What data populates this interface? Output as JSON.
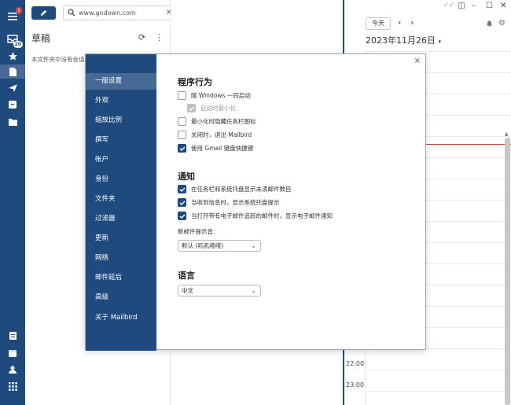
{
  "sidebar": {
    "menu_badge": "1",
    "inbox_badge": "20",
    "icons": [
      "menu-icon",
      "inbox-icon",
      "star-icon",
      "drafts-icon",
      "send-icon",
      "archive-icon",
      "folder-icon",
      "notes-icon",
      "calendar-icon",
      "contacts-icon",
      "apps-icon"
    ]
  },
  "mail_list": {
    "search_value": "www.gndown.com",
    "folder_title": "草稿",
    "empty_message": "本文件夹中没有会话"
  },
  "calendar": {
    "today_label": "今天",
    "date_label": "2023年11月26日",
    "hours": [
      "22:00",
      "23:00"
    ]
  },
  "settings": {
    "close_label": "×",
    "nav": [
      {
        "label": "一般设置",
        "active": true
      },
      {
        "label": "外观"
      },
      {
        "label": "缩放比例"
      },
      {
        "label": "撰写"
      },
      {
        "label": "帐户"
      },
      {
        "label": "身份"
      },
      {
        "label": "文件夹"
      },
      {
        "label": "过滤器"
      },
      {
        "label": "更新"
      },
      {
        "label": "网络"
      },
      {
        "label": "邮件延后"
      },
      {
        "label": "高级"
      },
      {
        "label": "关于 Mailbird"
      }
    ],
    "behavior": {
      "title": "程序行为",
      "options": [
        {
          "label": "随 Windows 一同启动",
          "checked": false
        },
        {
          "label": "启动时最小化",
          "checked": true,
          "disabled": true
        },
        {
          "label": "最小化时隐藏任务栏图标",
          "checked": false
        },
        {
          "label": "关闭时，退出 Mailbird",
          "checked": false
        },
        {
          "label": "使用 Gmail 键盘快捷键",
          "checked": true
        }
      ]
    },
    "notifications": {
      "title": "通知",
      "options": [
        {
          "label": "在任务栏和系统托盘显示未读邮件数目",
          "checked": true
        },
        {
          "label": "当收到信息时，显示系统托盘提示",
          "checked": true
        },
        {
          "label": "当打开带有电子邮件追踪的邮件时，显示电子邮件通知",
          "checked": true
        }
      ],
      "sound_label": "新邮件提示音:",
      "sound_value": "默认 (叽叽喳喳)"
    },
    "language": {
      "title": "语言",
      "value": "中文"
    }
  },
  "colors": {
    "brand": "#1e4a7e",
    "now_line": "#c0392b"
  }
}
